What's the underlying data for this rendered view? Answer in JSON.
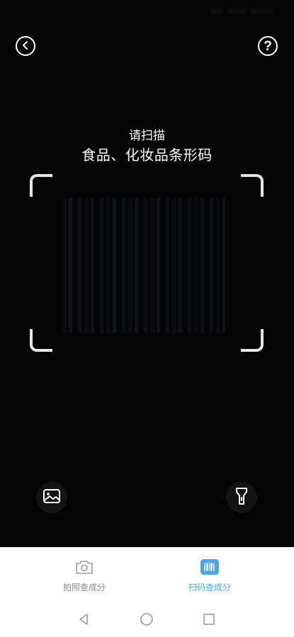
{
  "header": {
    "back_icon": "chevron-left-icon",
    "help_icon": "question-mark-icon",
    "help_glyph": "?"
  },
  "scanner": {
    "prompt_line1": "请扫描",
    "prompt_line2": "食品、化妆品条形码"
  },
  "tools": {
    "album_icon": "image-gallery-icon",
    "flashlight_icon": "flashlight-icon"
  },
  "tabs": [
    {
      "label": "拍照查成分",
      "icon": "camera-icon",
      "active": false,
      "color": "#8a8a8a"
    },
    {
      "label": "扫码查成分",
      "icon": "barcode-icon",
      "active": true,
      "color": "#4aa8df"
    }
  ],
  "system_nav": {
    "back_icon": "triangle-back-icon",
    "home_icon": "circle-home-icon",
    "recent_icon": "square-recent-icon"
  },
  "colors": {
    "background": "#050505",
    "accent": "#4aa8df",
    "frame": "#e6e6e6"
  }
}
